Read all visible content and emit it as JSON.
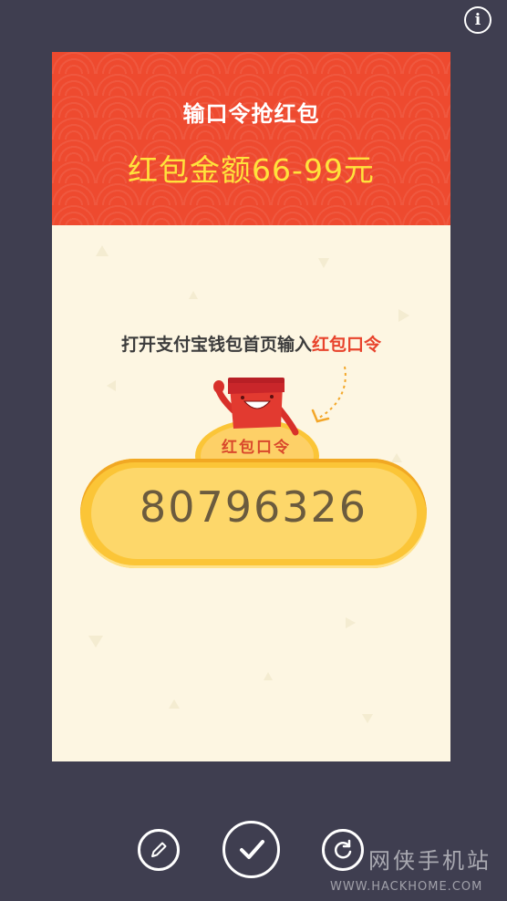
{
  "topbar": {
    "info_icon": "info-icon"
  },
  "header": {
    "title": "输口令抢红包",
    "amount": "红包金额66-99元"
  },
  "body": {
    "instruction_prefix": "打开支付宝钱包首页输入",
    "instruction_highlight": "红包口令",
    "coin_label": "红包口令",
    "code": "80796326"
  },
  "toolbar": {
    "edit_icon": "pencil-icon",
    "confirm_icon": "checkmark-icon",
    "refresh_icon": "refresh-icon"
  },
  "watermark": {
    "chinese": "网侠手机站",
    "site": "WWW.HACKHOME.COM"
  },
  "colors": {
    "background": "#3f3e50",
    "header_red": "#ee4a2f",
    "amount_yellow": "#ffe23c",
    "card_cream": "#fdf6e2",
    "highlight_red": "#e8432c",
    "code_yellow": "#fbc537"
  }
}
